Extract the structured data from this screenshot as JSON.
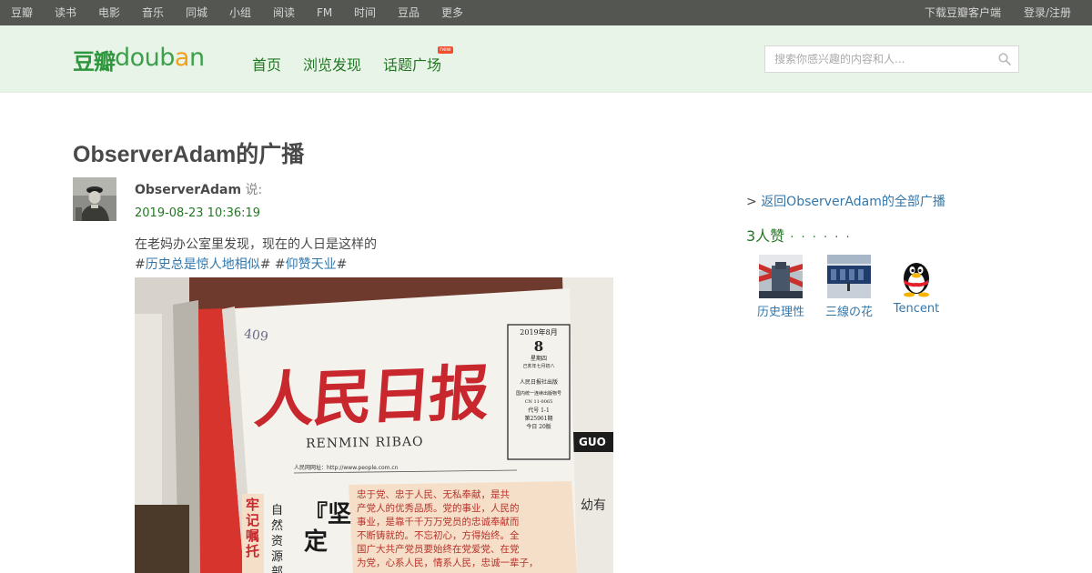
{
  "global_nav": {
    "left": [
      "豆瓣",
      "读书",
      "电影",
      "音乐",
      "同城",
      "小组",
      "阅读",
      "FM",
      "时间",
      "豆品",
      "更多"
    ],
    "download_client": "下载豆瓣客户端",
    "login": "登录/注册"
  },
  "header": {
    "logo_cn": "豆瓣",
    "logo_en_1": "doub",
    "logo_en_2": "a",
    "logo_en_3": "n",
    "nav": [
      "首页",
      "浏览发现",
      "话题广场"
    ],
    "new_badge": "new",
    "search_placeholder": "搜索你感兴趣的内容和人..."
  },
  "page": {
    "title": "ObserverAdam的广播"
  },
  "status": {
    "author": "ObserverAdam",
    "says": " 说:",
    "timestamp": "2019-08-23 10:36:19",
    "text": "在老妈办公室里发现，现在的人日是这样的",
    "tag_prefix": "#",
    "tag1": "历史总是惊人地相似",
    "tag_mid": "# #",
    "tag2": "仰赞天业",
    "tag_suffix": "#"
  },
  "photo": {
    "masthead": "人民日报",
    "pinyin": "RENMIN RIBAO",
    "date_line": "2019年8月",
    "day": "8",
    "weekday": "星期四",
    "lunar": "己亥年七月初八",
    "publisher": "人民日报社出版",
    "issn_line": "国内统一连续出版物号",
    "cn": "CN 11-0065",
    "code": "代号 1-1",
    "issue": "第25961期",
    "pages": "今日 20版",
    "website": "人民网网址：http://www.people.com.cn",
    "handwritten": "409",
    "side_red": "牢记嘱托",
    "side_black": "自然资源部",
    "big_quote": "『坚定",
    "article_lines": [
      "忠于党、忠于人民、无私奉献，是共",
      "产党人的优秀品质。党的事业，人民的",
      "事业，是靠千千万万党员的忠诚奉献而",
      "不断铸就的。不忘初心，方得始终。全",
      "国广大共产党员要始终在党爱党、在党",
      "为党，心系人民，情系人民，忠诚一辈子，"
    ],
    "right_paper": "GUO",
    "right_paper2": "幼有"
  },
  "sidebar": {
    "back_prefix": "> ",
    "back_link": "返回ObserverAdam的全部广播",
    "likes": "3人赞",
    "likes_more": "· · · · · ·",
    "likers": [
      {
        "name": "历史理性"
      },
      {
        "name": "三線の花"
      },
      {
        "name": "Tencent"
      }
    ]
  },
  "colors": {
    "nav_bg": "#545652",
    "header_bg": "#e9f4e9",
    "link_green": "#247724",
    "link_blue": "#3377aa",
    "masthead_red": "#c8272e"
  }
}
